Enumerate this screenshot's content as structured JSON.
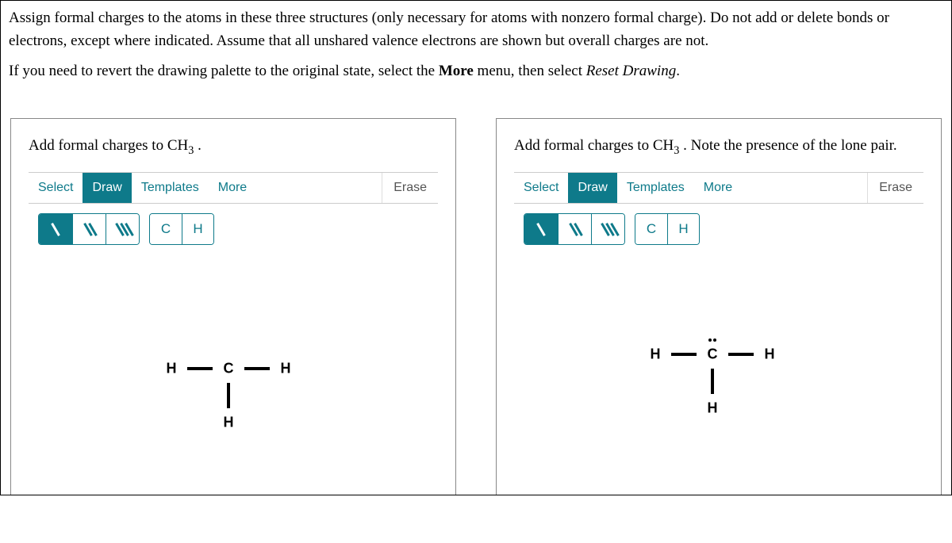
{
  "instructions": {
    "p1_pre": "Assign formal charges to the atoms in these three structures (only necessary for atoms with nonzero formal charge). Do not add or delete bonds or electrons, except where indicated. Assume that all unshared valence electrons are shown but overall charges are not.",
    "p2_a": "If you need to revert the drawing palette to the original state, select the ",
    "p2_b": "More",
    "p2_c": " menu, then select ",
    "p2_d": "Reset Drawing",
    "p2_e": "."
  },
  "panel_left": {
    "title_pre": "Add formal charges to CH",
    "title_sub": "3",
    "title_post": " ."
  },
  "panel_right": {
    "title_pre": "Add formal charges to CH",
    "title_sub": "3",
    "title_post": " . Note the presence of the lone pair."
  },
  "toolbar": {
    "select": "Select",
    "draw": "Draw",
    "templates": "Templates",
    "more": "More",
    "erase": "Erase",
    "elem_c": "C",
    "elem_h": "H"
  },
  "structure_left": {
    "h_left": "H",
    "c": "C",
    "h_right": "H",
    "h_bottom": "H"
  },
  "structure_right": {
    "h_left": "H",
    "c": "C",
    "h_right": "H",
    "h_bottom": "H"
  }
}
